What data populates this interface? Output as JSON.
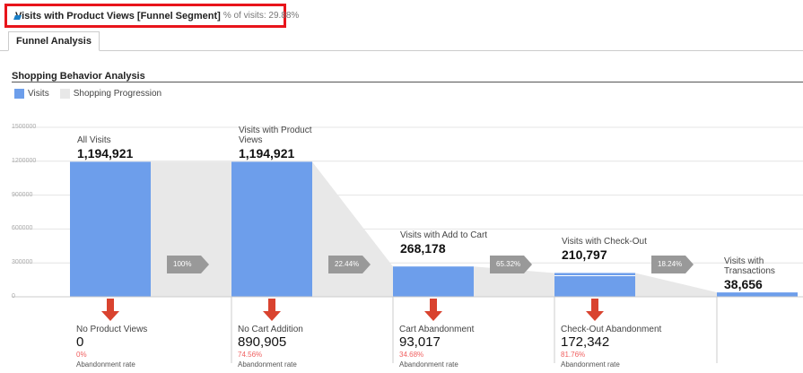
{
  "segment": {
    "name": "Visits with Product Views [Funnel Segment]",
    "pct_label": "% of visits: 29.88%"
  },
  "tab": "Funnel Analysis",
  "section_title": "Shopping Behavior Analysis",
  "legend": [
    {
      "label": "Visits",
      "color": "#6d9eeb"
    },
    {
      "label": "Shopping Progression",
      "color": "#e8e8e8"
    }
  ],
  "chart_data": {
    "type": "bar",
    "y_ticks": [
      "1500000",
      "1200000",
      "900000",
      "600000",
      "300000",
      "0"
    ],
    "ylim": [
      0,
      1500000
    ],
    "stages": [
      {
        "label": "All Visits",
        "value": 1194921,
        "display": "1,194,921"
      },
      {
        "label": "Visits with Product Views",
        "value": 1194921,
        "display": "1,194,921"
      },
      {
        "label": "Visits with Add to Cart",
        "value": 268178,
        "display": "268,178"
      },
      {
        "label": "Visits with Check-Out",
        "value": 210797,
        "display": "210,797"
      },
      {
        "label": "Visits with Transactions",
        "value": 38656,
        "display": "38,656"
      }
    ],
    "progression": [
      "100%",
      "22.44%",
      "65.32%",
      "18.24%"
    ],
    "abandonment": [
      {
        "label": "No Product Views",
        "value": "0",
        "rate": "0%",
        "rate_label": "Abandonment rate"
      },
      {
        "label": "No Cart Addition",
        "value": "890,905",
        "rate": "74.56%",
        "rate_label": "Abandonment rate"
      },
      {
        "label": "Cart Abandonment",
        "value": "93,017",
        "rate": "34.68%",
        "rate_label": "Abandonment rate"
      },
      {
        "label": "Check-Out Abandonment",
        "value": "172,342",
        "rate": "81.76%",
        "rate_label": "Abandonment rate"
      }
    ]
  }
}
